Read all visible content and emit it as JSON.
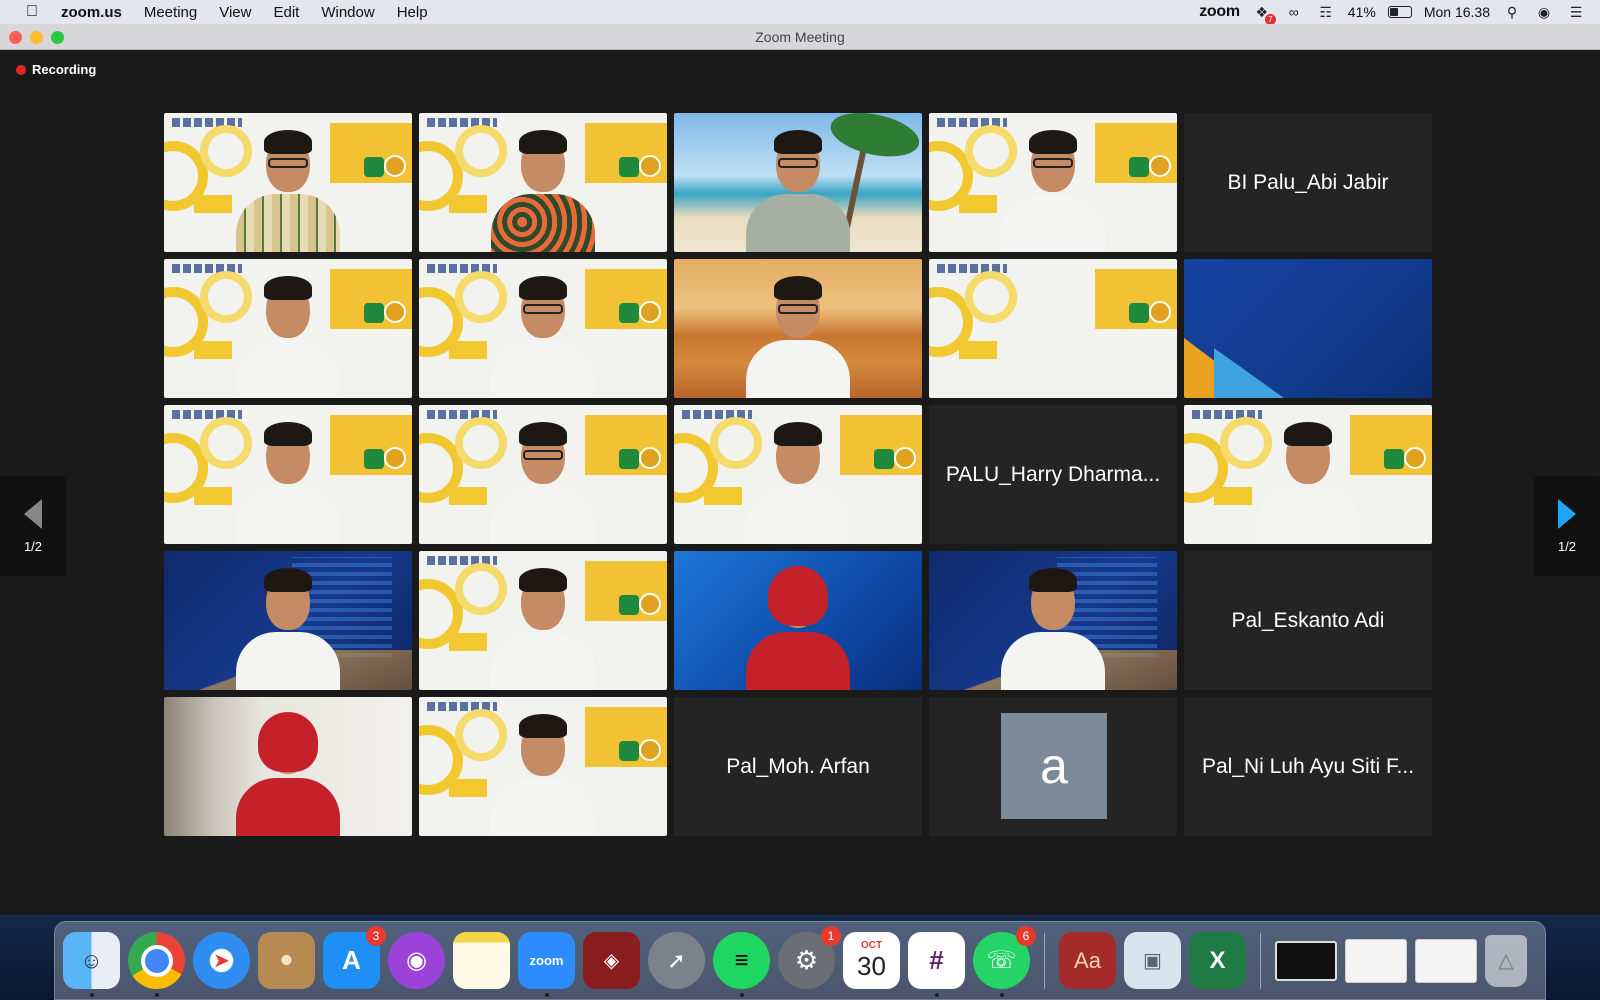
{
  "menubar": {
    "apple_icon": "apple-logo",
    "app_name": "zoom.us",
    "menus": [
      "Meeting",
      "View",
      "Edit",
      "Window",
      "Help"
    ],
    "status": {
      "zoom_label": "zoom",
      "dropbox_badge": "7",
      "battery_percent": "41%",
      "battery_level": 0.41,
      "clock": "Mon 16.38"
    }
  },
  "window": {
    "title": "Zoom Meeting"
  },
  "meeting": {
    "recording_label": "Recording",
    "recording_color": "#e02828",
    "speaking_color": "#2cc14b",
    "page_left": "1/2",
    "page_right": "1/2",
    "tiles": [
      {
        "type": "video",
        "bg": "workshop",
        "speaking": true
      },
      {
        "type": "video",
        "bg": "workshop"
      },
      {
        "type": "video",
        "bg": "beach"
      },
      {
        "type": "video",
        "bg": "workshop"
      },
      {
        "type": "name",
        "name": "BI Palu_Abi Jabir"
      },
      {
        "type": "video",
        "bg": "workshop"
      },
      {
        "type": "video",
        "bg": "workshop"
      },
      {
        "type": "video",
        "bg": "desert"
      },
      {
        "type": "video",
        "bg": "workshop",
        "empty": true
      },
      {
        "type": "slide",
        "bg": "slide"
      },
      {
        "type": "video",
        "bg": "workshop"
      },
      {
        "type": "video",
        "bg": "workshop"
      },
      {
        "type": "video",
        "bg": "workshop"
      },
      {
        "type": "name",
        "name": "PALU_Harry Dharma..."
      },
      {
        "type": "video",
        "bg": "workshop"
      },
      {
        "type": "video",
        "bg": "bi"
      },
      {
        "type": "video",
        "bg": "workshop"
      },
      {
        "type": "video",
        "bg": "digifest"
      },
      {
        "type": "video",
        "bg": "bi"
      },
      {
        "type": "name",
        "name": "Pal_Eskanto Adi"
      },
      {
        "type": "video",
        "bg": "room"
      },
      {
        "type": "video",
        "bg": "workshop"
      },
      {
        "type": "name",
        "name": "Pal_Moh. Arfan"
      },
      {
        "type": "avatar",
        "letter": "a"
      },
      {
        "type": "name",
        "name": "Pal_Ni Luh Ayu Siti F..."
      }
    ]
  },
  "dock": {
    "apps": [
      {
        "name": "finder"
      },
      {
        "name": "chrome"
      },
      {
        "name": "safari"
      },
      {
        "name": "contacts"
      },
      {
        "name": "app-store",
        "badge": "3"
      },
      {
        "name": "podcasts"
      },
      {
        "name": "notes"
      },
      {
        "name": "zoom",
        "label": "zoom"
      },
      {
        "name": "photo-booth"
      },
      {
        "name": "launchpad"
      },
      {
        "name": "spotify"
      },
      {
        "name": "system-preferences",
        "badge": "1"
      },
      {
        "name": "calendar",
        "month": "OCT",
        "day": "30"
      },
      {
        "name": "slack"
      },
      {
        "name": "whatsapp",
        "badge": "6"
      },
      {
        "name": "dictionary",
        "label": "Aa"
      },
      {
        "name": "preview"
      },
      {
        "name": "excel"
      }
    ]
  }
}
